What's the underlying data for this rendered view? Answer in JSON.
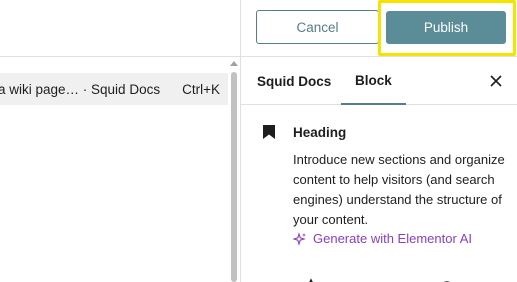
{
  "editor": {
    "command_row": {
      "text": "a wiki page… · Squid Docs",
      "shortcut": "Ctrl+K"
    }
  },
  "header": {
    "cancel_label": "Cancel",
    "publish_label": "Publish",
    "highlight_color": "#f5e400",
    "accent_color": "#557e89"
  },
  "sidebar": {
    "tabs": [
      {
        "label": "Squid Docs"
      },
      {
        "label": "Block"
      }
    ],
    "close_icon": "close-icon",
    "block": {
      "icon": "bookmark-icon",
      "title": "Heading",
      "description": "Introduce new sections and organize content to help visitors (and search engines) understand the structure of your content.",
      "ai_link": {
        "icon": "sparkle-icon",
        "label": "Generate with Elementor AI",
        "color": "#8a3fbc"
      }
    }
  }
}
